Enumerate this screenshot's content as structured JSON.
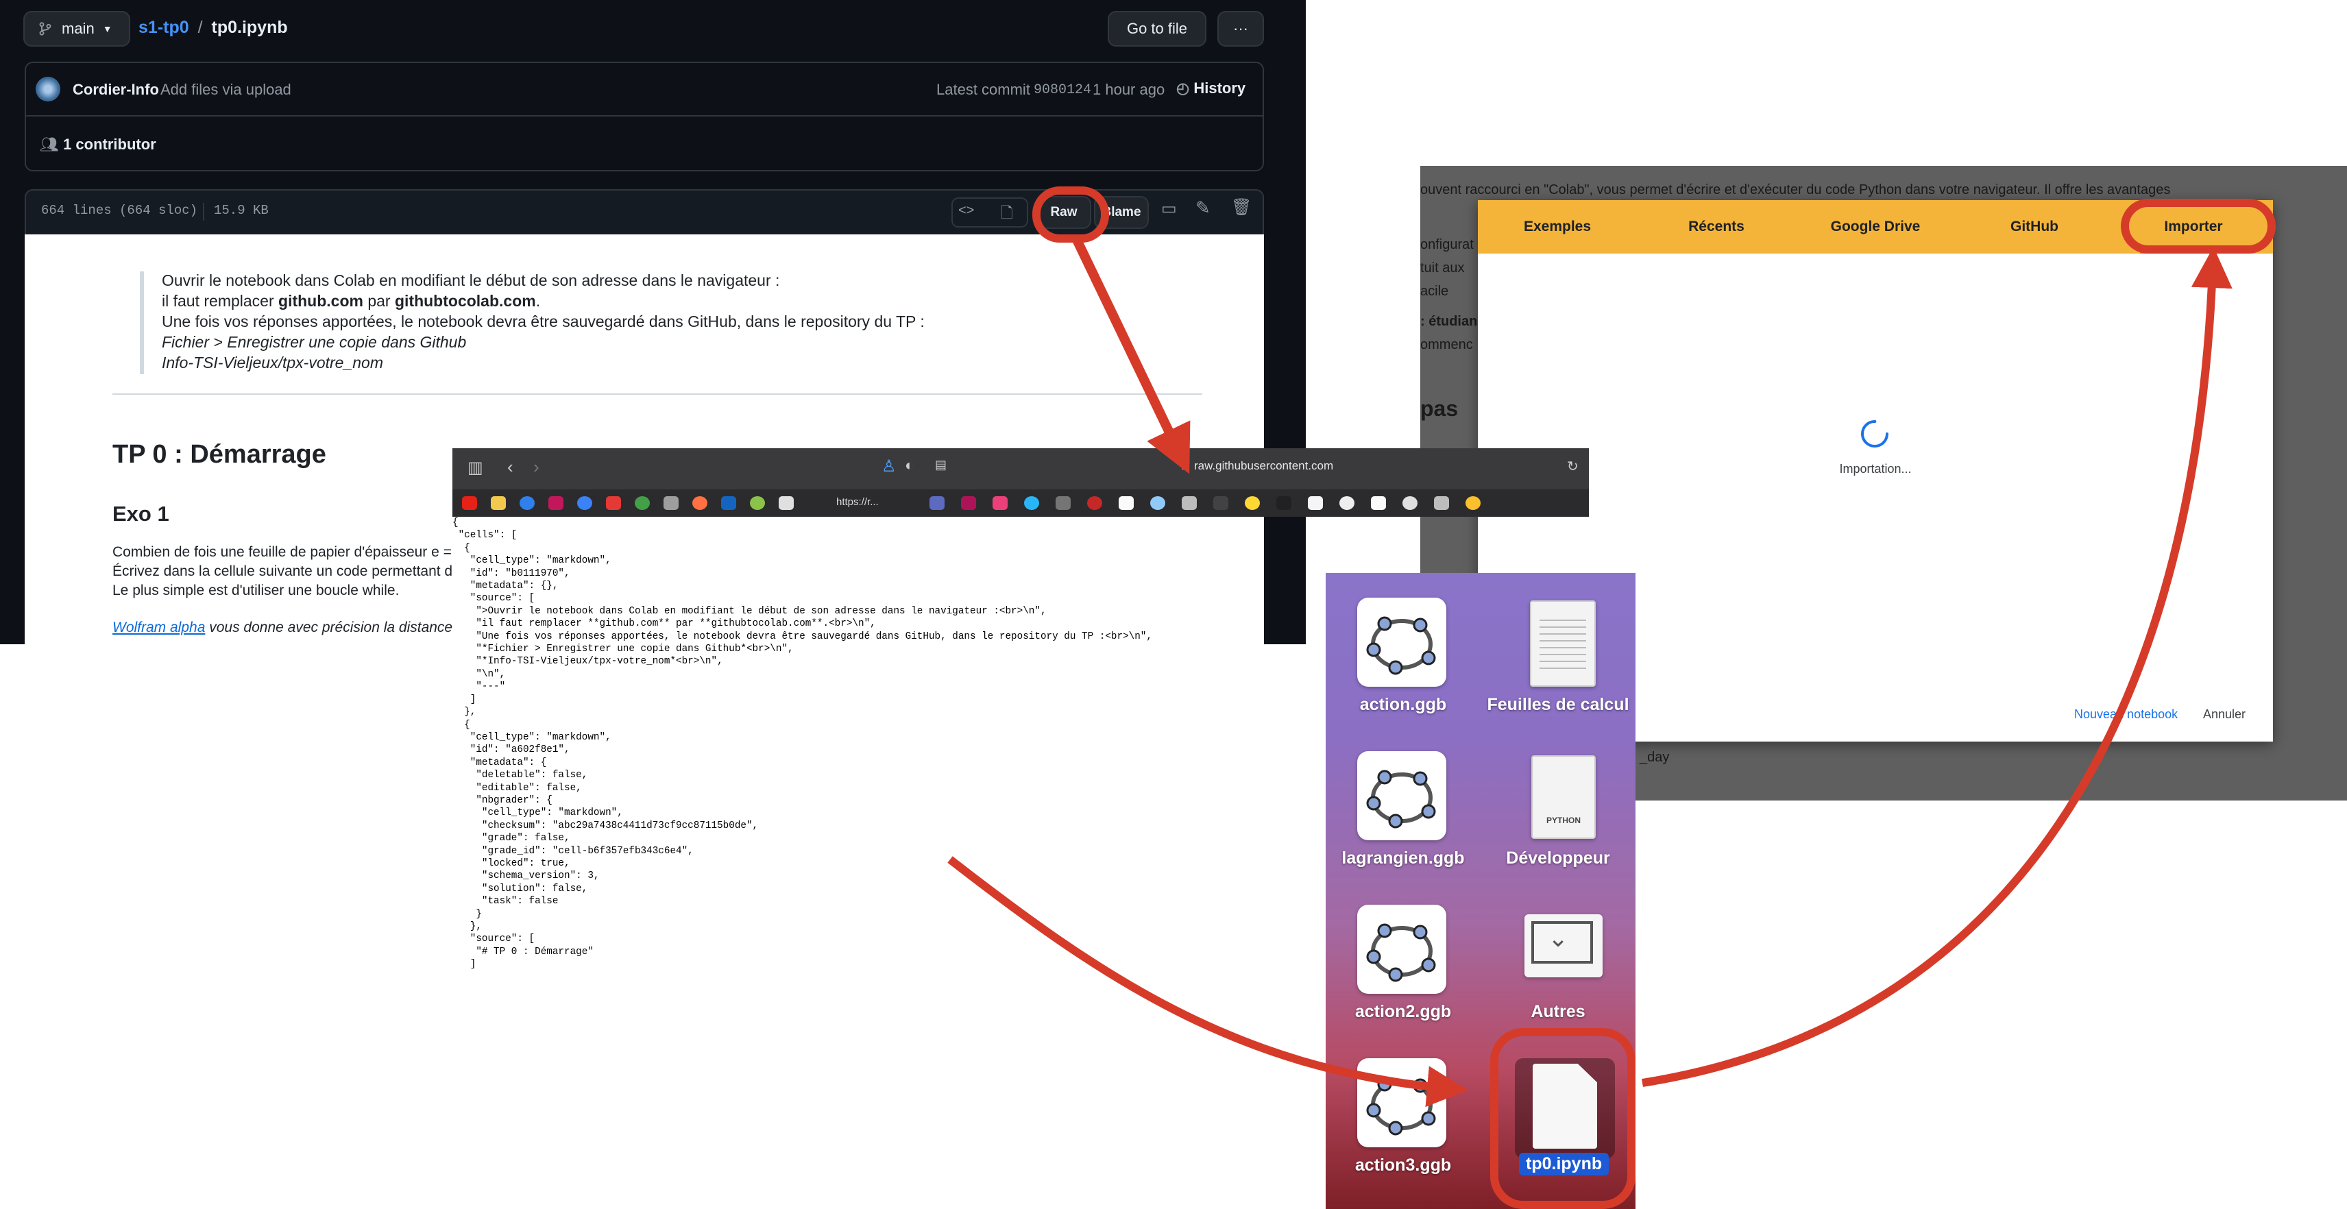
{
  "github": {
    "branch": "main",
    "repo": "s1-tp0",
    "separator": "/",
    "file": "tp0.ipynb",
    "go_to_file": "Go to file",
    "more": "···",
    "commit_author": "Cordier-Info",
    "commit_message": "Add files via upload",
    "latest_commit_label": "Latest commit",
    "commit_hash": "9080124",
    "commit_time": "1 hour ago",
    "history": "History",
    "contributors": "1 contributor",
    "lines": "664 lines (664 sloc)",
    "size": "15.9 KB",
    "raw": "Raw",
    "blame": "Blame"
  },
  "notebook": {
    "intro1": "Ouvrir le notebook dans Colab en modifiant le début de son adresse dans le navigateur :",
    "intro2_a": "il faut remplacer ",
    "intro2_b": "github.com",
    "intro2_c": " par ",
    "intro2_d": "githubtocolab.com",
    "intro2_e": ".",
    "intro3": "Une fois vos réponses apportées, le notebook devra être sauvegardé dans GitHub, dans le repository du TP :",
    "intro4": "Fichier > Enregistrer une copie dans Github",
    "intro5": "Info-TSI-Vieljeux/tpx-votre_nom",
    "title": "TP 0 : Démarrage",
    "exo": "Exo 1",
    "p1": "Combien de fois une feuille de papier d'épaisseur e =",
    "p2": "Écrivez dans la cellule suivante un code permettant d",
    "p3": "Le plus simple est d'utiliser une boucle while.",
    "link": "Wolfram alpha",
    "p4": " vous donne avec précision la distance"
  },
  "colab": {
    "bg_line1": "ouvent raccourci en \"Colab\", vous permet d'écrire et d'exécuter du code Python dans votre navigateur. Il offre les avantages",
    "bg_line2": "onfigurat",
    "bg_line3": "tuit aux",
    "bg_line4": "acile",
    "bg_line5": ": étudian",
    "bg_line6": "ommenc",
    "bg_line7": "pas",
    "bg_line8": "_day",
    "tabs": [
      "Exemples",
      "Récents",
      "Google Drive",
      "GitHub",
      "Importer"
    ],
    "loading": "Importation...",
    "new_notebook": "Nouveau notebook",
    "cancel": "Annuler"
  },
  "safari": {
    "url": "raw.githubusercontent.com",
    "bookmark": "https://r..."
  },
  "raw_json": "{\n \"cells\": [\n  {\n   \"cell_type\": \"markdown\",\n   \"id\": \"b0111970\",\n   \"metadata\": {},\n   \"source\": [\n    \">Ouvrir le notebook dans Colab en modifiant le début de son adresse dans le navigateur :<br>\\n\",\n    \"il faut remplacer **github.com** par **githubtocolab.com**.<br>\\n\",\n    \"Une fois vos réponses apportées, le notebook devra être sauvegardé dans GitHub, dans le repository du TP :<br>\\n\",\n    \"*Fichier > Enregistrer une copie dans Github*<br>\\n\",\n    \"*Info-TSI-Vieljeux/tpx-votre_nom*<br>\\n\",\n    \"\\n\",\n    \"---\"\n   ]\n  },\n  {\n   \"cell_type\": \"markdown\",\n   \"id\": \"a602f8e1\",\n   \"metadata\": {\n    \"deletable\": false,\n    \"editable\": false,\n    \"nbgrader\": {\n     \"cell_type\": \"markdown\",\n     \"checksum\": \"abc29a7438c4411d73cf9cc87115b0de\",\n     \"grade\": false,\n     \"grade_id\": \"cell-b6f357efb343c6e4\",\n     \"locked\": true,\n     \"schema_version\": 3,\n     \"solution\": false,\n     \"task\": false\n    }\n   },\n   \"source\": [\n    \"# TP 0 : Démarrage\"\n   ]",
  "finder": {
    "items": [
      "action.ggb",
      "Feuilles de calcul",
      "lagrangien.ggb",
      "Développeur",
      "action2.ggb",
      "Autres",
      "action3.ggb",
      "tp0.ipynb"
    ],
    "python_label": "PYTHON"
  },
  "colors": {
    "annotation": "#d63b2a",
    "colab_tabs": "#f4b43a",
    "github_bg": "#0d1117",
    "link": "#0969da"
  }
}
